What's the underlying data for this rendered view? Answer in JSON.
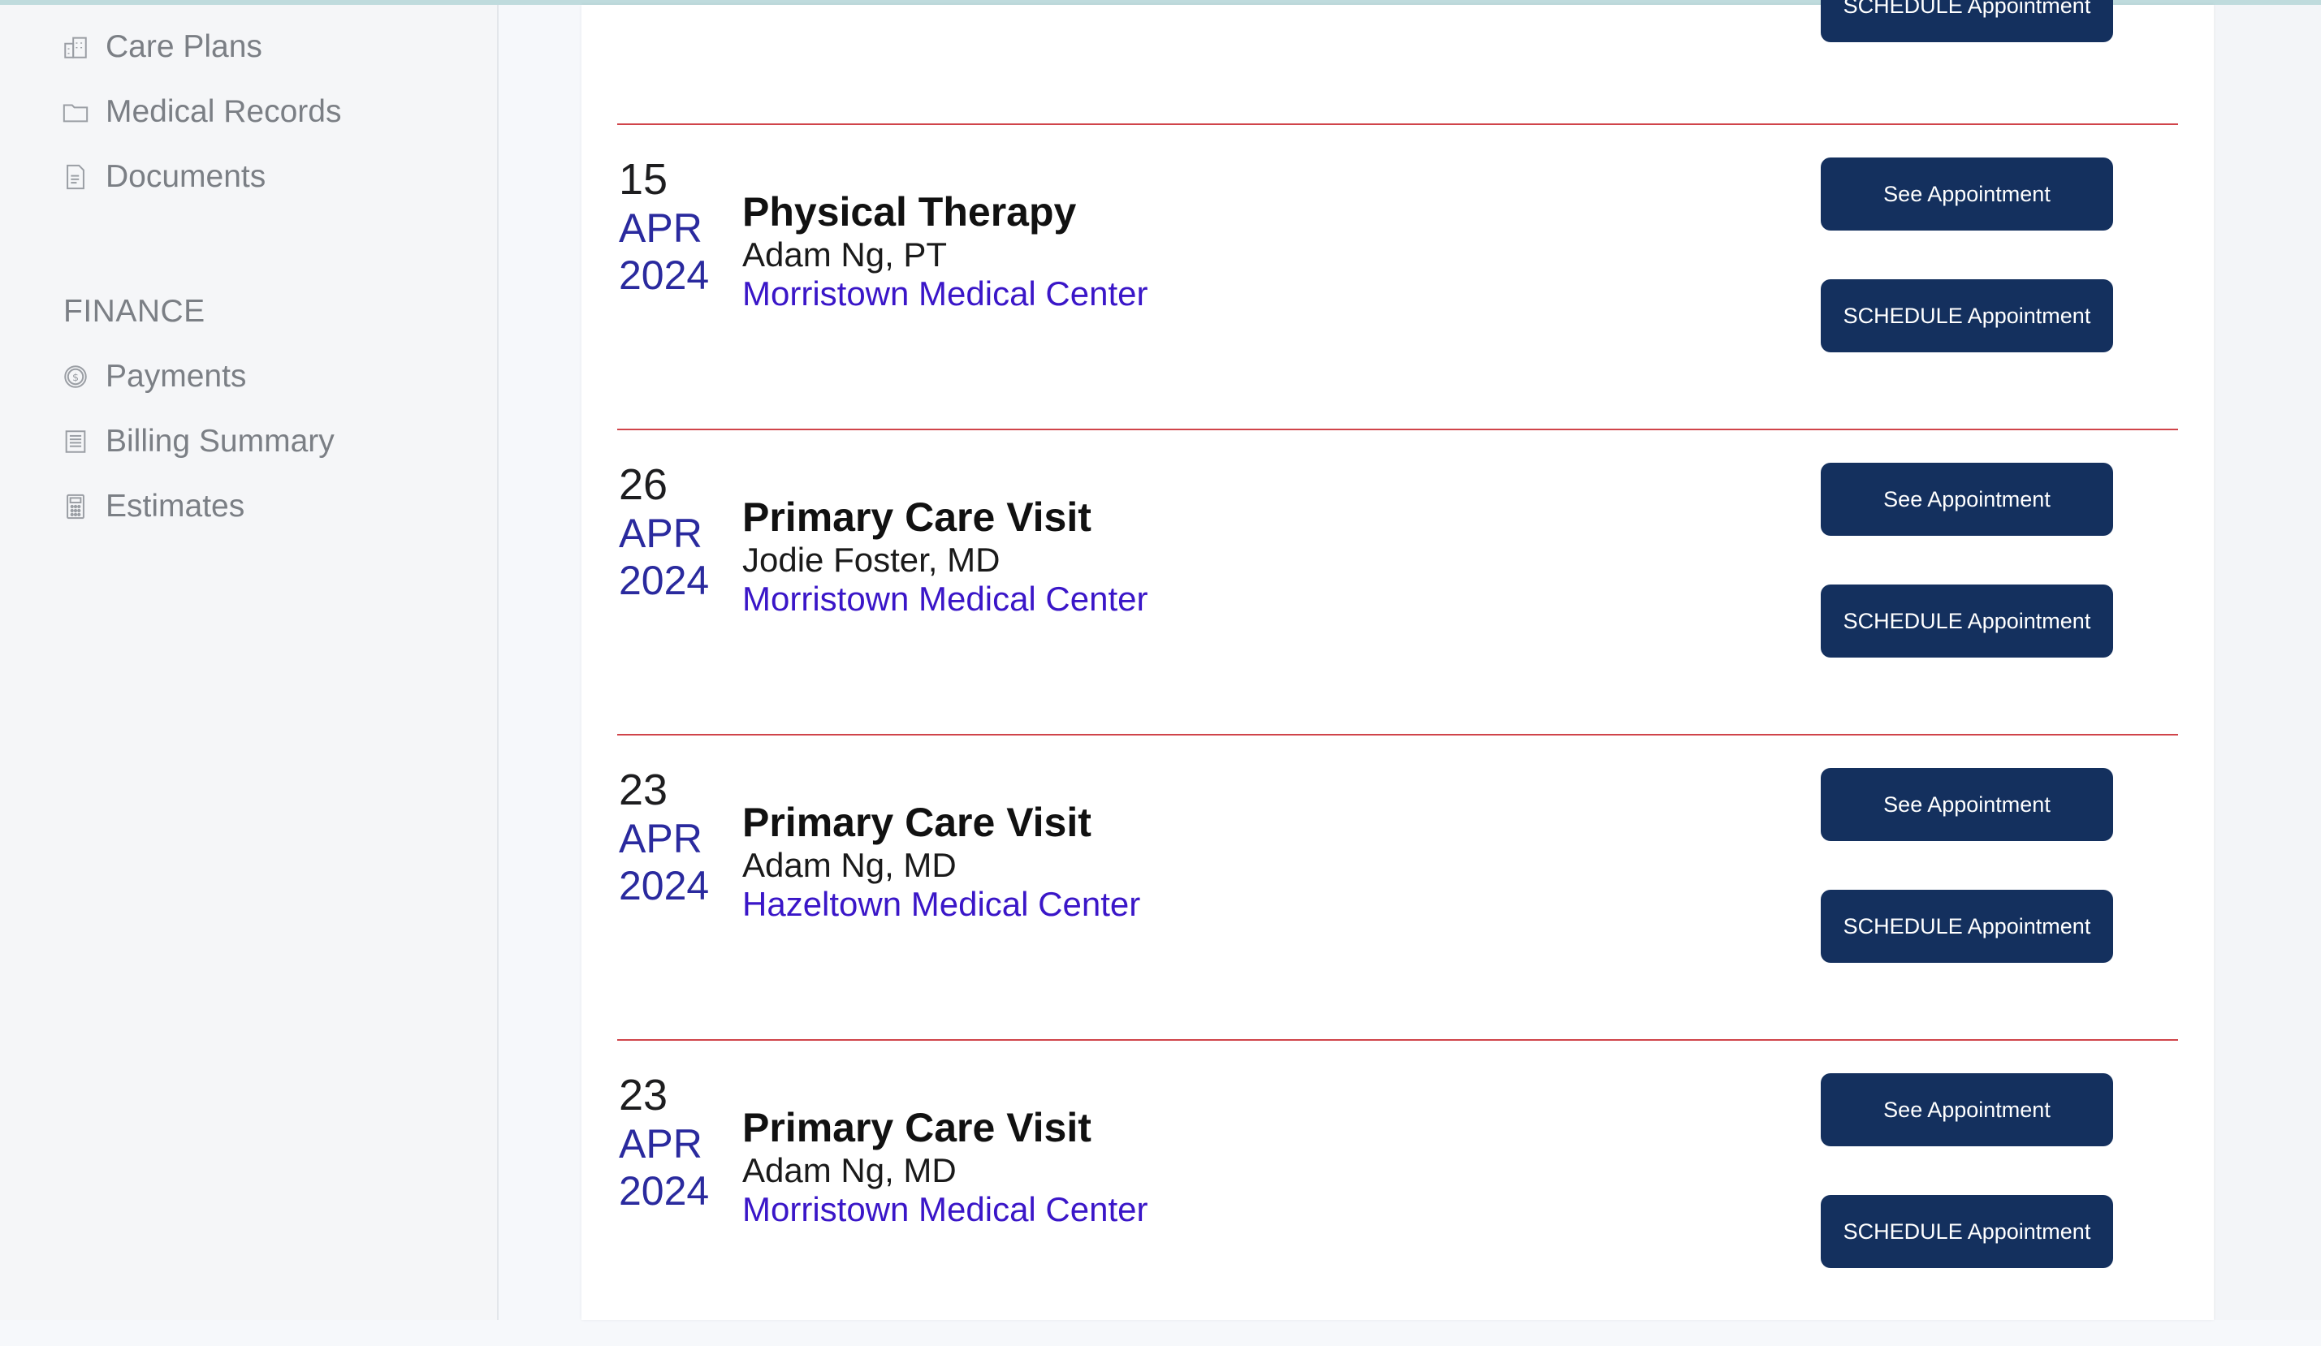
{
  "sidebar": {
    "items_top": [
      {
        "label": "Care Plans",
        "icon": "building-icon"
      },
      {
        "label": "Medical Records",
        "icon": "folder-icon"
      },
      {
        "label": "Documents",
        "icon": "document-icon"
      }
    ],
    "finance": {
      "title": "FINANCE",
      "items": [
        {
          "label": "Payments",
          "icon": "dollar-coin-icon"
        },
        {
          "label": "Billing Summary",
          "icon": "receipt-icon"
        },
        {
          "label": "Estimates",
          "icon": "calculator-icon"
        }
      ]
    }
  },
  "buttons": {
    "see": "See Appointment",
    "schedule": "SCHEDULE Appointment"
  },
  "appointments": [
    {
      "day": "15",
      "month": "APR",
      "year": "2024",
      "title": "Physical Therapy",
      "provider": "Adam Ng, PT",
      "location": "Morristown Medical Center"
    },
    {
      "day": "26",
      "month": "APR",
      "year": "2024",
      "title": "Primary Care Visit",
      "provider": "Jodie Foster, MD",
      "location": "Morristown Medical Center"
    },
    {
      "day": "23",
      "month": "APR",
      "year": "2024",
      "title": "Primary Care Visit",
      "provider": "Adam Ng, MD",
      "location": "Hazeltown Medical Center"
    },
    {
      "day": "23",
      "month": "APR",
      "year": "2024",
      "title": "Primary Care Visit",
      "provider": "Adam Ng, MD",
      "location": "Morristown Medical Center"
    }
  ],
  "colors": {
    "button_bg": "#14305e",
    "divider": "#d0444a",
    "accent_text": "#3a16c8",
    "date_accent": "#2a2a9e"
  }
}
